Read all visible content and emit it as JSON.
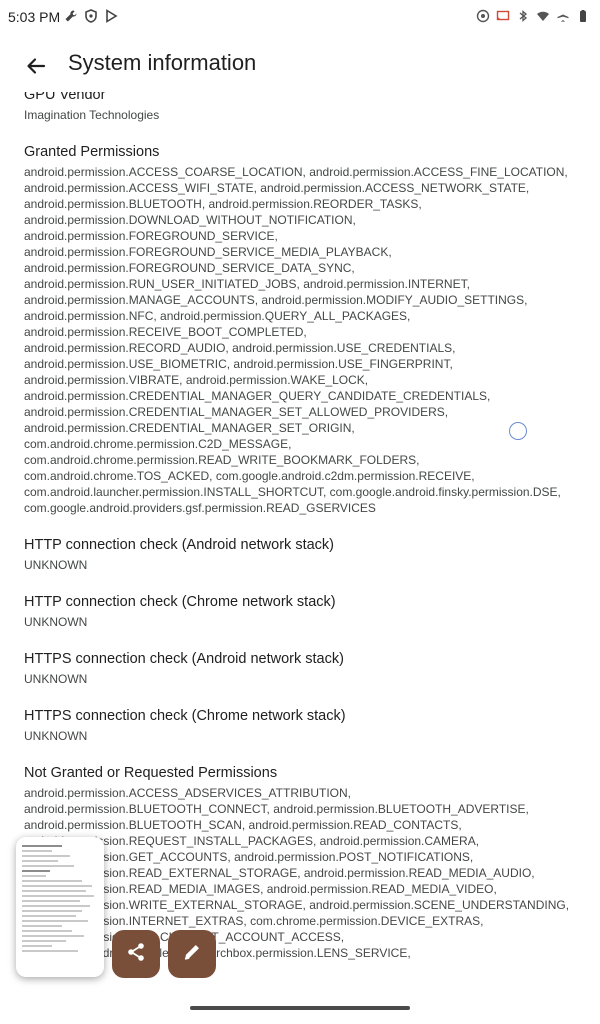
{
  "status_bar": {
    "time": "5:03 PM",
    "left_icons": [
      "wrench-icon",
      "shield-icon",
      "play-store-icon"
    ],
    "right_icons": [
      "location-icon",
      "cast-icon",
      "bluetooth-icon",
      "wifi-icon",
      "airplane-icon",
      "battery-icon"
    ]
  },
  "app_bar": {
    "title": "System information",
    "back_icon": "arrow-back-icon"
  },
  "gpu_vendor": {
    "title": "GPU Vendor",
    "value": "Imagination Technologies"
  },
  "granted_permissions": {
    "title": "Granted Permissions",
    "lines": [
      "android.permission.ACCESS_COARSE_LOCATION, android.permission.ACCESS_FINE_LOCATION,",
      "android.permission.ACCESS_WIFI_STATE, android.permission.ACCESS_NETWORK_STATE,",
      "android.permission.BLUETOOTH, android.permission.REORDER_TASKS,",
      "android.permission.DOWNLOAD_WITHOUT_NOTIFICATION,",
      "android.permission.FOREGROUND_SERVICE,",
      "android.permission.FOREGROUND_SERVICE_MEDIA_PLAYBACK,",
      "android.permission.FOREGROUND_SERVICE_DATA_SYNC,",
      "android.permission.RUN_USER_INITIATED_JOBS, android.permission.INTERNET,",
      "android.permission.MANAGE_ACCOUNTS, android.permission.MODIFY_AUDIO_SETTINGS,",
      "android.permission.NFC, android.permission.QUERY_ALL_PACKAGES,",
      "android.permission.RECEIVE_BOOT_COMPLETED,",
      "android.permission.RECORD_AUDIO, android.permission.USE_CREDENTIALS,",
      "android.permission.USE_BIOMETRIC, android.permission.USE_FINGERPRINT,",
      "android.permission.VIBRATE, android.permission.WAKE_LOCK,",
      "android.permission.CREDENTIAL_MANAGER_QUERY_CANDIDATE_CREDENTIALS,",
      "android.permission.CREDENTIAL_MANAGER_SET_ALLOWED_PROVIDERS,",
      "android.permission.CREDENTIAL_MANAGER_SET_ORIGIN,",
      "com.android.chrome.permission.C2D_MESSAGE,",
      "com.android.chrome.permission.READ_WRITE_BOOKMARK_FOLDERS,",
      "com.android.chrome.TOS_ACKED, com.google.android.c2dm.permission.RECEIVE,",
      "com.android.launcher.permission.INSTALL_SHORTCUT, com.google.android.finsky.permission.DSE,",
      "com.google.android.providers.gsf.permission.READ_GSERVICES"
    ]
  },
  "checks": [
    {
      "title": "HTTP connection check (Android network stack)",
      "value": "UNKNOWN"
    },
    {
      "title": "HTTP connection check (Chrome network stack)",
      "value": "UNKNOWN"
    },
    {
      "title": "HTTPS connection check (Android network stack)",
      "value": "UNKNOWN"
    },
    {
      "title": "HTTPS connection check (Chrome network stack)",
      "value": "UNKNOWN"
    }
  ],
  "not_granted": {
    "title": "Not Granted or Requested Permissions",
    "lines": [
      "android.permission.ACCESS_ADSERVICES_ATTRIBUTION,",
      "android.permission.BLUETOOTH_CONNECT, android.permission.BLUETOOTH_ADVERTISE,",
      "android.permission.BLUETOOTH_SCAN, android.permission.READ_CONTACTS,",
      "android.permission.REQUEST_INSTALL_PACKAGES, android.permission.CAMERA,",
      "android.permission.GET_ACCOUNTS, android.permission.POST_NOTIFICATIONS,",
      "android.permission.READ_EXTERNAL_STORAGE, android.permission.READ_MEDIA_AUDIO,",
      "android.permission.READ_MEDIA_IMAGES, android.permission.READ_MEDIA_VIDEO,",
      "android.permission.WRITE_EXTERNAL_STORAGE, android.permission.SCENE_UNDERSTANDING,",
      "android.permission.INTERNET_EXTRAS, com.chrome.permission.DEVICE_EXTRAS,",
      "android.permission.GET_CURRENT_ACCOUNT_ACCESS,",
      "com.google.android.googlequicksearchbox.permission.LENS_SERVICE,"
    ]
  },
  "screenshot_overlay": {
    "share_icon": "share-icon",
    "edit_icon": "edit-pencil-icon"
  }
}
